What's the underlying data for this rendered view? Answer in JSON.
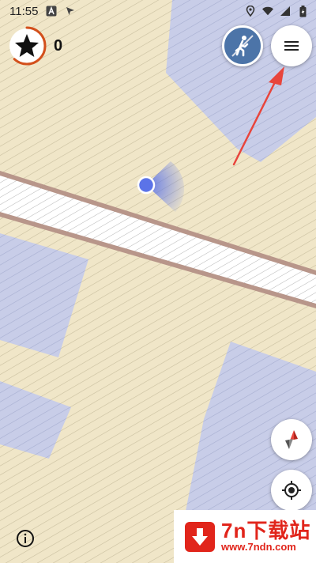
{
  "status_bar": {
    "time": "11:55",
    "icons": [
      "keyboard-a-icon",
      "cursor-icon",
      "location-pin-icon",
      "wifi-icon",
      "signal-icon",
      "battery-icon"
    ]
  },
  "score": {
    "count": "0",
    "icon": "star-icon",
    "progress": 0.62,
    "ring_color": "#d3501c"
  },
  "controls": {
    "mode_icon": "walking-person-icon",
    "menu_icon": "hamburger-menu-icon",
    "compass_icon": "compass-icon",
    "locate_icon": "crosshair-locate-icon",
    "info_icon": "info-icon"
  },
  "map": {
    "land_color": "#f0e6c8",
    "building_color": "#c8cde8",
    "road_color": "#ffffff",
    "road_edge_color": "#b8968a",
    "user_dot_color": "#5b73e8"
  },
  "annotation": {
    "arrow_color": "#e8453c"
  },
  "watermark": {
    "title": "7n下载站",
    "url": "www.7ndn.com",
    "brand_color": "#e1251b"
  }
}
